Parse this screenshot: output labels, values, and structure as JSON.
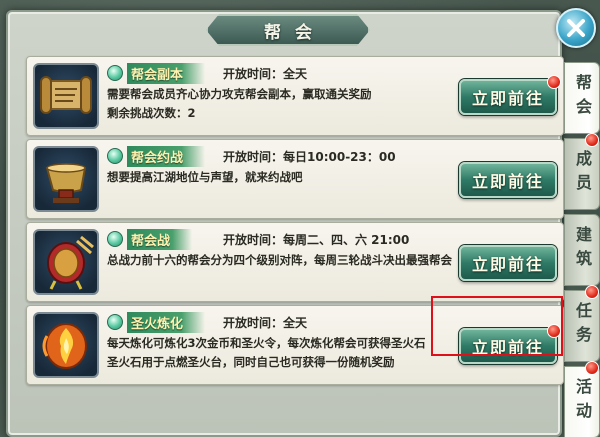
{
  "window": {
    "title": "帮会"
  },
  "entries": [
    {
      "name": "帮会副本",
      "open_time": "开放时间：全天",
      "desc_lines": [
        "需要帮会成员齐心协力攻克帮会副本，赢取通关奖励",
        "剩余挑战次数：2"
      ],
      "button": "立即前往",
      "icon": "scroll-icon",
      "has_badge": true
    },
    {
      "name": "帮会约战",
      "open_time": "开放时间：每日10:00-23：00",
      "desc_lines": [
        "想要提高江湖地位与声望，就来约战吧",
        ""
      ],
      "button": "立即前往",
      "icon": "war-horn-icon",
      "has_badge": false
    },
    {
      "name": "帮会战",
      "open_time": "开放时间：每周二、四、六 21:00",
      "desc_lines": [
        "总战力前十六的帮会分为四个级别对阵，每周三轮战斗决出最强帮会",
        ""
      ],
      "button": "立即前往",
      "icon": "drum-icon",
      "has_badge": false
    },
    {
      "name": "圣火炼化",
      "open_time": "开放时间：全天",
      "desc_lines": [
        "每天炼化可炼化3次金币和圣火令，每次炼化帮会可获得圣火石",
        "圣火石用于点燃圣火台，同时自己也可获得一份随机奖励"
      ],
      "button": "立即前往",
      "icon": "holy-fire-icon",
      "has_badge": true
    }
  ],
  "side_tabs": [
    {
      "label": "帮会",
      "active": true,
      "has_badge": false
    },
    {
      "label": "成员",
      "active": false,
      "has_badge": true
    },
    {
      "label": "建筑",
      "active": false,
      "has_badge": false
    },
    {
      "label": "任务",
      "active": false,
      "has_badge": true
    },
    {
      "label": "活动",
      "active": true,
      "has_badge": true
    }
  ],
  "colors": {
    "highlight": "#e0101a",
    "button_green": "#2f7a66",
    "name_tag_green": "#2f8a5c",
    "badge_red": "#e02a1a"
  }
}
